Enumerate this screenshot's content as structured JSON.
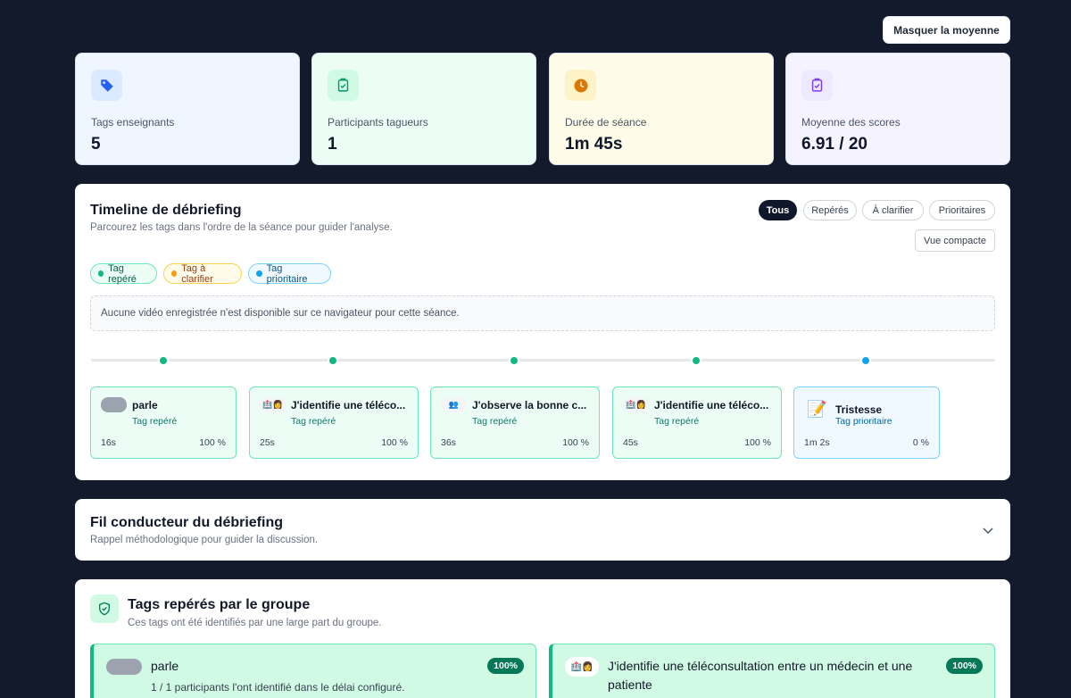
{
  "header": {
    "toggle_average_label": "Masquer la moyenne"
  },
  "stats": [
    {
      "label": "Tags enseignants",
      "value": "5",
      "icon": "tag-icon"
    },
    {
      "label": "Participants tagueurs",
      "value": "1",
      "icon": "clipboard-check-icon"
    },
    {
      "label": "Durée de séance",
      "value": "1m 45s",
      "icon": "clock-icon"
    },
    {
      "label": "Moyenne des scores",
      "value": "6.91 / 20",
      "icon": "clipboard-check-icon"
    }
  ],
  "timeline": {
    "title": "Timeline de débriefing",
    "subtitle": "Parcourez les tags dans l'ordre de la séance pour guider l'analyse.",
    "filters": [
      "Tous",
      "Repérés",
      "À clarifier",
      "Prioritaires"
    ],
    "active_filter": "Tous",
    "compact_label": "Vue compacte",
    "legend": [
      "Tag repéré",
      "Tag à clarifier",
      "Tag prioritaire"
    ],
    "no_video": "Aucune vidéo enregistrée n'est disponible sur ce navigateur pour cette séance.",
    "items": [
      {
        "title": "parle",
        "kind": "Tag repéré",
        "time": "16s",
        "percent": "100 %"
      },
      {
        "title": "J'identifie une téléco...",
        "kind": "Tag repéré",
        "time": "25s",
        "percent": "100 %"
      },
      {
        "title": "J'observe la bonne c...",
        "kind": "Tag repéré",
        "time": "36s",
        "percent": "100 %"
      },
      {
        "title": "J'identifie une téléco...",
        "kind": "Tag repéré",
        "time": "45s",
        "percent": "100 %"
      },
      {
        "title": "Tristesse",
        "kind": "Tag prioritaire",
        "time": "1m 2s",
        "percent": "0 %"
      }
    ]
  },
  "guide": {
    "title": "Fil conducteur du débriefing",
    "subtitle": "Rappel méthodologique pour guider la discussion."
  },
  "group_tags": {
    "title": "Tags repérés par le groupe",
    "subtitle": "Ces tags ont été identifiés par une large part du groupe.",
    "items": [
      {
        "title": "parle",
        "detail": "1 / 1 participants l'ont identifié dans le délai configuré.",
        "badge": "100%"
      },
      {
        "title": "J'identifie une téléconsultation entre un médecin et une patiente",
        "badge": "100%"
      }
    ]
  },
  "colors": {
    "reperer": "#10b981",
    "clarifier": "#f59e0b",
    "prioritaire": "#0ea5e9",
    "background": "#121a2b"
  }
}
